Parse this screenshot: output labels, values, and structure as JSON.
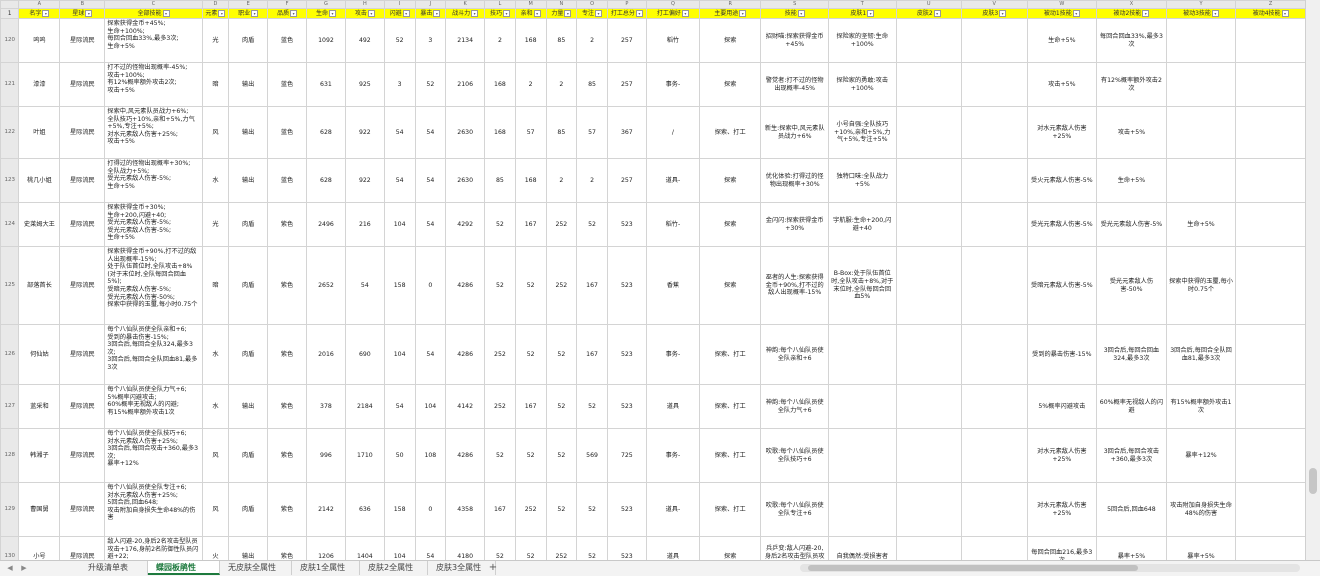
{
  "sheet": {
    "column_letters": [
      "",
      "A",
      "B",
      "C",
      "D",
      "E",
      "F",
      "G",
      "H",
      "I",
      "J",
      "K",
      "L",
      "M",
      "N",
      "O",
      "P",
      "Q",
      "R",
      "S",
      "T",
      "U",
      "V",
      "W",
      "X",
      "Y",
      "Z"
    ],
    "headers": [
      "1",
      "名字",
      "星球",
      "全部技能",
      "元素",
      "职业",
      "品质",
      "生命",
      "攻击",
      "闪避",
      "暴击",
      "战斗力",
      "技巧",
      "亲和",
      "力量",
      "专注",
      "打工总分",
      "打工偏好",
      "主要用途",
      "技能",
      "皮肤1",
      "皮肤2",
      "皮肤3",
      "被动1技能",
      "被动2技能",
      "被动3技能",
      "被动4技能"
    ],
    "rows": [
      [
        "120",
        "呜呜",
        "星际流民",
        "探索获得金币+45%;\n生命+100%;\n每回合回血33%,最多3次;\n生命+5%",
        "光",
        "肉盾",
        "蓝色",
        "1092",
        "492",
        "52",
        "3",
        "2134",
        "2",
        "168",
        "85",
        "2",
        "257",
        "稻竹",
        "探索",
        "招财喵:探索获得金币+45%",
        "探险家的坚韧:生命+100%",
        "",
        "",
        "生命+5%",
        "每回合回血33%,最多3次",
        "",
        ""
      ],
      [
        "121",
        "漆漆",
        "星际流民",
        "打不过的怪物出现概率-45%;\n攻击+100%;\n有12%概率额外攻击2次;\n攻击+5%",
        "暗",
        "输出",
        "蓝色",
        "631",
        "925",
        "3",
        "52",
        "2106",
        "168",
        "2",
        "2",
        "85",
        "257",
        "事务-",
        "探索",
        "警觉者:打不过的怪物出现概率-45%",
        "探险家的勇敢:攻击+100%",
        "",
        "",
        "攻击+5%",
        "有12%概率额外攻击2次",
        "",
        ""
      ],
      [
        "122",
        "叶姐",
        "星际流民",
        "探索中,风元素队员战力+6%;\n全队技巧+10%,亲和+5%,力气+5%,专注+5%;\n对水元素敌人伤害+25%;\n攻击+5%",
        "风",
        "输出",
        "蓝色",
        "628",
        "922",
        "54",
        "54",
        "2630",
        "168",
        "57",
        "85",
        "57",
        "367",
        "/",
        "探索、打工",
        "新生:探索中,风元素队员战力+6%",
        "小号自强:全队技巧+10%,亲和+5%,力气+5%,专注+5%",
        "",
        "",
        "对水元素敌人伤害+25%",
        "攻击+5%",
        "",
        ""
      ],
      [
        "123",
        "桃几小姐",
        "星际流民",
        "打得过的怪物出现概率+30%;\n全队战力+5%;\n受光元素敌人伤害-5%;\n生命+5%",
        "水",
        "输出",
        "蓝色",
        "628",
        "922",
        "54",
        "54",
        "2630",
        "85",
        "168",
        "2",
        "2",
        "257",
        "道具-",
        "探索",
        "优化体验:打得过的怪物出现概率+30%",
        "独特口味:全队战力+5%",
        "",
        "",
        "受火元素敌人伤害-5%",
        "生命+5%",
        "",
        ""
      ],
      [
        "124",
        "史莱姆大王",
        "星际流民",
        "探索获得金币+30%;\n生命+200,闪避+40;\n受光元素敌人伤害-5%;\n受光元素敌人伤害-5%;\n生命+5%",
        "光",
        "肉盾",
        "紫色",
        "2496",
        "216",
        "104",
        "54",
        "4292",
        "52",
        "167",
        "252",
        "52",
        "523",
        "稻竹-",
        "探索",
        "金闪闪:探索获得金币+30%",
        "宇航服:生命+200,闪避+40",
        "",
        "",
        "受光元素敌人伤害-5%",
        "受光元素敌人伤害-5%",
        "生命+5%",
        ""
      ],
      [
        "125",
        "部落首长",
        "星际流民",
        "探索获得金币+90%,打不过的敌人出现概率-15%;\n处于队伍首位时,全队攻击+8%(对于末位时,全队每回合回血5%);\n受暗元素敌人伤害-5%;\n受光元素敌人伤害-50%;\n探索中获得的玉璽,每小时0.75个",
        "暗",
        "肉盾",
        "紫色",
        "2652",
        "54",
        "158",
        "0",
        "4286",
        "52",
        "52",
        "252",
        "167",
        "523",
        "香蕉",
        "探索",
        "巫者的人生:探索获得金币+90%,打不过的敌人出现概率-15%",
        "B-Box:处于队伍首位时,全队攻击+8%,对于末位时,全队每回合回血5%",
        "",
        "",
        "受暗元素敌人伤害-5%",
        "受光元素敌人伤害-50%",
        "探索中获得的玉璽,每小时0.75个",
        ""
      ],
      [
        "126",
        "何仙姑",
        "星际流民",
        "每个八仙队员使全队亲和+6;\n受到的暴击伤害-15%;\n3回合后,每回合全队324,最多3次;\n3回合后,每回合全队回血81,最多3次",
        "水",
        "肉盾",
        "紫色",
        "2016",
        "690",
        "104",
        "54",
        "4286",
        "252",
        "52",
        "52",
        "167",
        "523",
        "事务-",
        "探索、打工",
        "神韵:每个八仙队员使全队亲和+6",
        "",
        "",
        "",
        "受到的暴击伤害-15%",
        "3回合后,每回合回血324,最多3次",
        "3回合后,每回合全队回血81,最多3次",
        ""
      ],
      [
        "127",
        "蓝采和",
        "星际流民",
        "每个八仙队员使全队力气+6;\n5%概率闪避攻击;\n60%概率无视敌人的闪避;\n有15%概率额外攻击1次",
        "水",
        "输出",
        "紫色",
        "378",
        "2184",
        "54",
        "104",
        "4142",
        "252",
        "167",
        "52",
        "52",
        "523",
        "道具",
        "探索、打工",
        "神韵:每个八仙队员使全队力气+6",
        "",
        "",
        "",
        "5%概率闪避攻击",
        "60%概率无视敌人的闪避",
        "有15%概率额外攻击1次",
        ""
      ],
      [
        "128",
        "韩湘子",
        "星际流民",
        "每个八仙队员使全队技巧+6;\n对水元素敌人伤害+25%;\n3回合后,每回合攻击+360,最多3次;\n暴率+12%",
        "风",
        "肉盾",
        "紫色",
        "996",
        "1710",
        "50",
        "108",
        "4286",
        "52",
        "52",
        "52",
        "569",
        "725",
        "事务-",
        "探索、打工",
        "吹歌:每个八仙队员使全队技巧+6",
        "",
        "",
        "",
        "对水元素敌人伤害+25%",
        "3回合后,每回合攻击+360,最多3次",
        "暴率+12%",
        ""
      ],
      [
        "129",
        "曹国舅",
        "星际流民",
        "每个八仙队员使全队专注+6;\n对水元素敌人伤害+25%;\n5回合后,回血648;\n攻击附加自身损失生命48%的伤害",
        "风",
        "肉盾",
        "紫色",
        "2142",
        "636",
        "158",
        "0",
        "4358",
        "167",
        "252",
        "52",
        "52",
        "523",
        "道具-",
        "探索、打工",
        "吹歌:每个八仙队员使全队专注+6",
        "",
        "",
        "",
        "对水元素敌人伤害+25%",
        "5回合后,回血648",
        "攻击附加自身损失生命48%的伤害",
        ""
      ],
      [
        "130",
        "小号",
        "星际流民",
        "敌人闪避-20,身后2名攻击型队员攻击+176,身前2名防御性队员闪避+22;\n...",
        "火",
        "输出",
        "紫色",
        "1206",
        "1404",
        "104",
        "54",
        "4180",
        "52",
        "52",
        "252",
        "52",
        "523",
        "道具",
        "探索",
        "兵乒变:敌人闪避-20,身后2名攻击型队员攻击",
        "自我偶然:受损害者",
        "",
        "",
        "每回合回血216,最多3次",
        "暴率+5%",
        "暴率+5%",
        ""
      ]
    ]
  },
  "tabs": [
    "升级清单表",
    "蝶园板鹃性",
    "无皮肤全属性",
    "皮肤1全属性",
    "皮肤2全属性",
    "皮肤3全属性"
  ],
  "active_tab": 1,
  "add_tab_label": "+",
  "nav_prev": "◀",
  "nav_next": "▶"
}
